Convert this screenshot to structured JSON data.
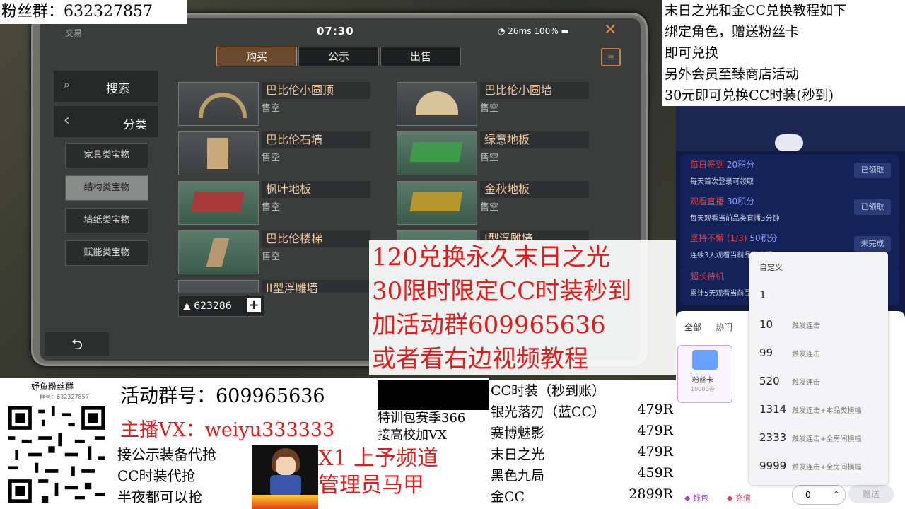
{
  "game": {
    "trade_label": "交易",
    "time": "07:30",
    "network": "26ms 100%",
    "close_icon": "close-icon",
    "tabs": [
      "购买",
      "公示",
      "出售"
    ],
    "active_tab": 0,
    "search_label": "搜索",
    "category_label": "分类",
    "categories": [
      "家具类宝物",
      "结构类宝物",
      "墙纸类宝物",
      "赋能类宝物"
    ],
    "selected_category": 1,
    "items": [
      {
        "name": "巴比伦小圆顶",
        "status": "售空"
      },
      {
        "name": "巴比伦小圆墙",
        "status": "售空"
      },
      {
        "name": "巴比伦石墙",
        "status": "售空"
      },
      {
        "name": "绿意地板",
        "status": "售空"
      },
      {
        "name": "枫叶地板",
        "status": "售空"
      },
      {
        "name": "金秋地板",
        "status": "售空"
      },
      {
        "name": "巴比伦楼梯",
        "status": "售空"
      },
      {
        "name": "I型浮雕墙",
        "status": ""
      },
      {
        "name": "II型浮雕墙",
        "status": ""
      }
    ],
    "coins": "623286",
    "back_icon": "back-arrow-icon"
  },
  "overlays": {
    "fans_group_top": "粉丝群：632327857",
    "top_right_lines": [
      "末日之光和金CC兑换教程如下",
      "绑定角色，赠送粉丝卡",
      "即可兑换",
      "另外会员至臻商店活动",
      "30元即可兑换CC时装(秒到)"
    ],
    "red_lines": [
      "120兑换永久末日之光",
      "30限时限定CC时装秒到",
      "加活动群609965636",
      "或者看右边视频教程"
    ],
    "qr_title": "妤鱼粉丝群",
    "qr_sub": "群号：632327857",
    "activity_group": "活动群号：609965636",
    "anchor_vx": "主播VX：weiyu333333",
    "left_lines": [
      "接公示装备代抢",
      "CC时装代抢",
      "半夜都可以抢"
    ],
    "mid_lines": [
      "特训包赛季366",
      "接高校加VX"
    ],
    "yt_lines": [
      "X1 上予频道",
      "管理员马甲"
    ],
    "price_header": "CC时装（秒到账）",
    "prices": [
      {
        "name": "银光落刃（蓝CC）",
        "price": "479R"
      },
      {
        "name": "赛博魅影",
        "price": "479R"
      },
      {
        "name": "末日之光",
        "price": "479R"
      },
      {
        "name": "黑色九局",
        "price": "459R"
      },
      {
        "name": "金CC",
        "price": "2899R"
      }
    ]
  },
  "stream_panel": {
    "tasks": [
      {
        "title": "每日签到",
        "points": "20积分",
        "desc": "每天首次登录可领取",
        "btn": "已领取"
      },
      {
        "title": "观看直播",
        "points": "30积分",
        "desc": "每天观看当前品类直播3分钟",
        "btn": "已领取"
      },
      {
        "title": "坚持不懈",
        "progress": "(1/3)",
        "points": "50积分",
        "desc": "连续3天观看当前品类直播",
        "btn": "未完成"
      },
      {
        "title": "超长待机",
        "desc": "累计5天观看当前品类直播",
        "btn": ""
      }
    ],
    "gift_tabs": [
      "全部",
      "热门"
    ],
    "gift_label": "粉丝卡",
    "gift_price": "1000C券",
    "custom_title": "自定义",
    "custom_options": [
      {
        "num": "1",
        "desc": ""
      },
      {
        "num": "10",
        "desc": "触发连击"
      },
      {
        "num": "99",
        "desc": "触发连击"
      },
      {
        "num": "520",
        "desc": "触发连击"
      },
      {
        "num": "1314",
        "desc": "触发连击+本品类横幅"
      },
      {
        "num": "2333",
        "desc": "触发连击+全房间横幅"
      },
      {
        "num": "9999",
        "desc": "触发连击+全房间横幅"
      }
    ],
    "wallet_label": "钱包",
    "recharge_label": "充值",
    "qty_value": "0",
    "send_label": "赠送"
  },
  "colors": {
    "accent_orange": "#c8834a",
    "red_text": "#e41b1b",
    "panel_blue": "#0e1a40"
  }
}
